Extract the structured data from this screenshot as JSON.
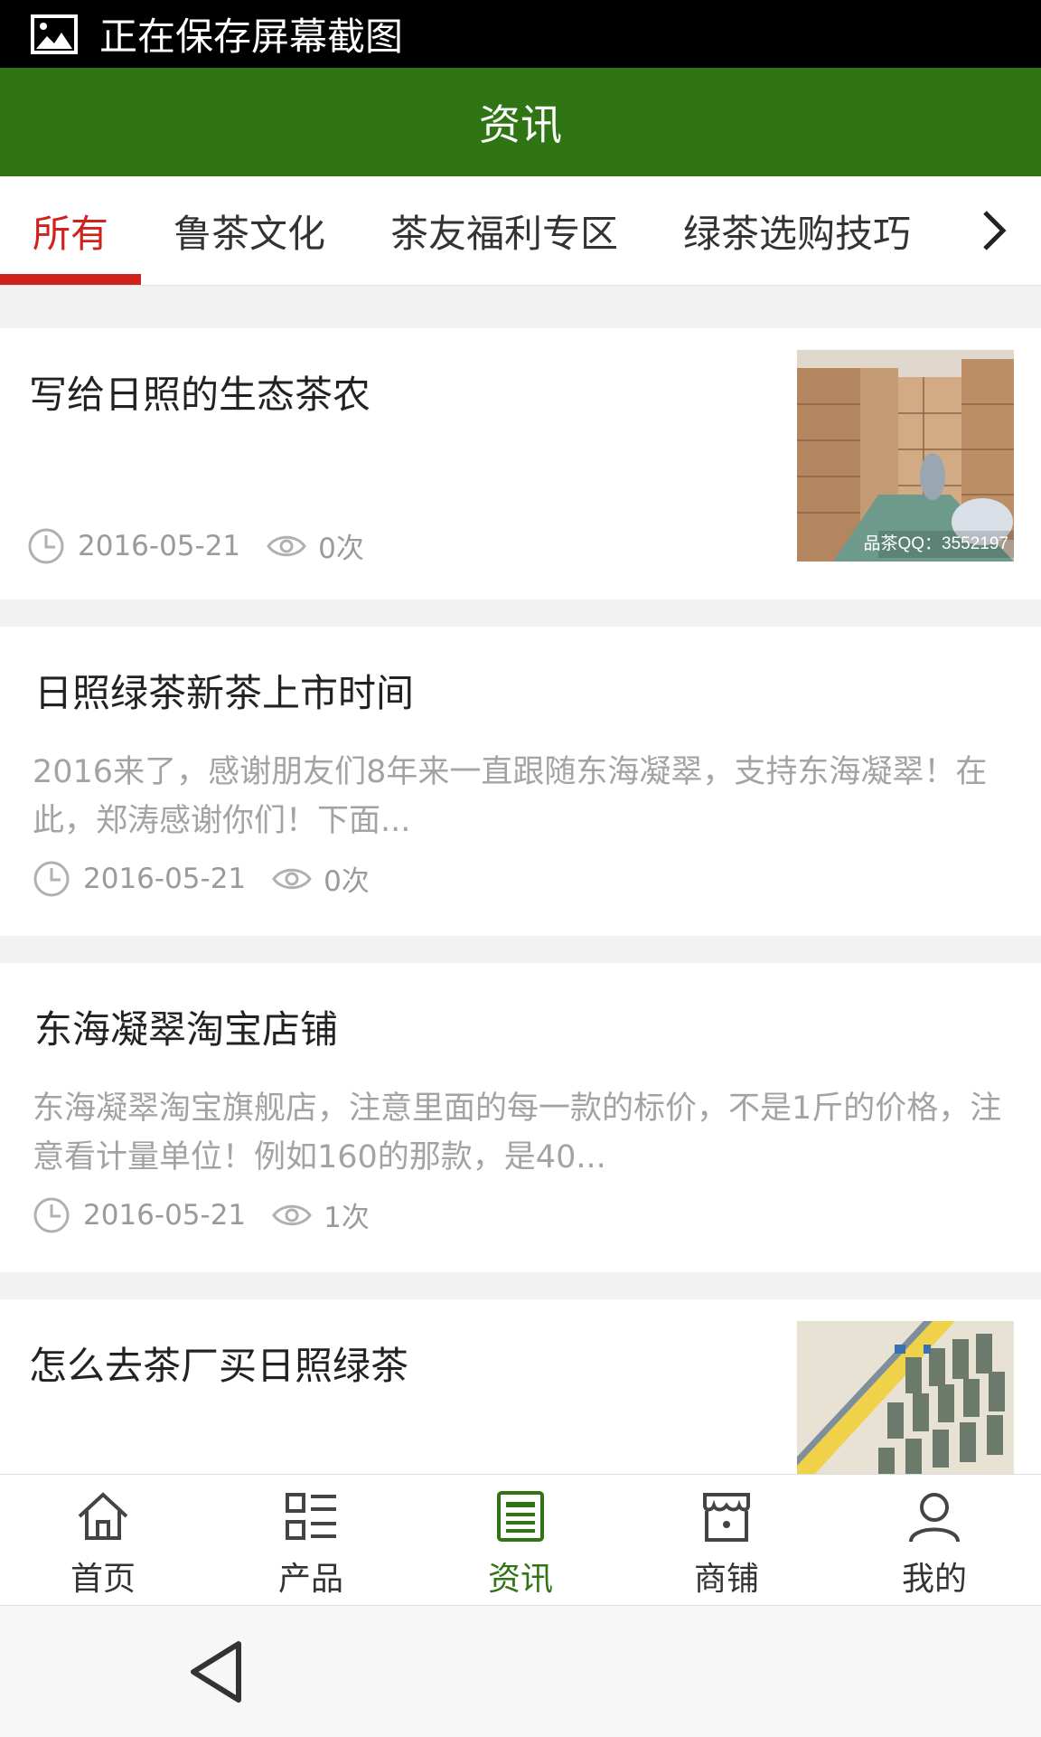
{
  "status_bar": {
    "text": "正在保存屏幕截图",
    "icon": "image-icon"
  },
  "header": {
    "title": "资讯",
    "color": "#2f7513"
  },
  "tabs": {
    "items": [
      {
        "label": "所有",
        "active": true
      },
      {
        "label": "鲁茶文化"
      },
      {
        "label": "茶友福利专区"
      },
      {
        "label": "绿茶选购技巧"
      }
    ],
    "more_icon": "chevron-right-icon",
    "active_color": "#d0221c"
  },
  "articles": [
    {
      "title": "写给日照的生态茶农",
      "date": "2016-05-21",
      "views": "0次",
      "thumbnail_watermark": "品茶QQ：3552197"
    },
    {
      "title": "日照绿茶新茶上市时间",
      "summary": "2016来了，感谢朋友们8年来一直跟随东海凝翠，支持东海凝翠！在此，郑涛感谢你们！下面...",
      "date": "2016-05-21",
      "views": "0次"
    },
    {
      "title": "东海凝翠淘宝店铺",
      "summary": "东海凝翠淘宝旗舰店，注意里面的每一款的标价，不是1斤的价格，注意看计量单位！例如160的那款，是40...",
      "date": "2016-05-21",
      "views": "1次"
    },
    {
      "title": "怎么去茶厂买日照绿茶"
    }
  ],
  "bottom_nav": [
    {
      "label": "首页",
      "icon": "home-icon"
    },
    {
      "label": "产品",
      "icon": "grid-list-icon"
    },
    {
      "label": "资讯",
      "icon": "news-icon",
      "active": true
    },
    {
      "label": "商铺",
      "icon": "store-icon"
    },
    {
      "label": "我的",
      "icon": "user-icon"
    }
  ],
  "system_nav": {
    "back_icon": "back-triangle-icon"
  }
}
